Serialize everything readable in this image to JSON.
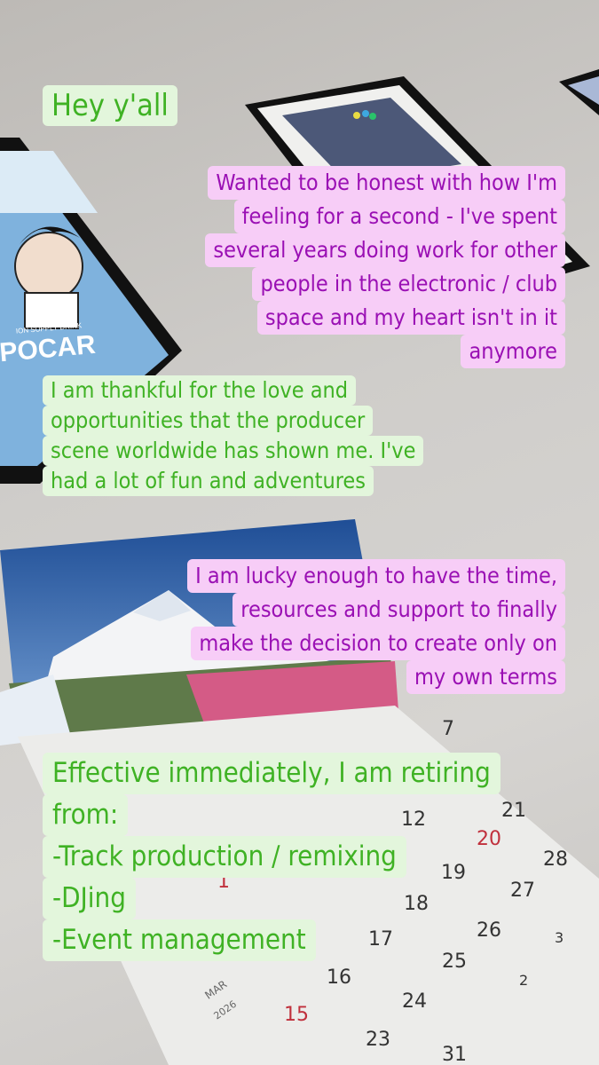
{
  "story": {
    "messages": [
      {
        "style": "green",
        "lines": [
          "Hey y'all"
        ]
      },
      {
        "style": "pink",
        "lines": [
          "Wanted to be honest with how I'm",
          "feeling for a second - I've spent",
          "several years doing work for other",
          "people in the electronic / club",
          "space and my heart isn't in it",
          "anymore"
        ]
      },
      {
        "style": "green",
        "lines": [
          "I am thankful for the love and",
          "opportunities that the producer",
          "scene worldwide has shown me. I've",
          "had a lot of fun and adventures"
        ]
      },
      {
        "style": "pink",
        "lines": [
          "I am lucky enough to have the time,",
          "resources and support to finally",
          "make the decision to create only on",
          "my own terms"
        ]
      },
      {
        "style": "green",
        "lines": [
          "Effective immediately, I am retiring",
          "from:",
          "-Track production / remixing",
          "-DJing",
          "-Event management"
        ]
      }
    ]
  },
  "photo": {
    "poster_text": "POCAR",
    "poster_small_text": "ION SUPPLY DRINK",
    "calendar_month": "MAR",
    "calendar_year": "2026",
    "calendar_numbers": [
      "7",
      "12",
      "21",
      "19",
      "20",
      "28",
      "1",
      "18",
      "26",
      "27",
      "3",
      "17",
      "25",
      "16",
      "2",
      "15",
      "24",
      "23",
      "31"
    ]
  },
  "colors": {
    "green_bg": "#e3f6dc",
    "green_text": "#3fb224",
    "pink_bg": "#f7cdf7",
    "pink_text": "#9a10b4"
  }
}
